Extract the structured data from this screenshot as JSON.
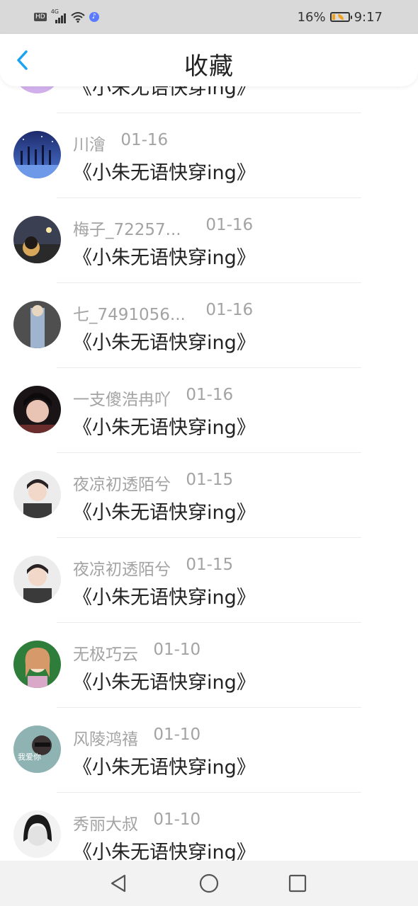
{
  "status_bar": {
    "hd": "HD",
    "network": "4G",
    "music": "♪",
    "battery": "16%",
    "time": "9:17"
  },
  "header": {
    "title": "收藏"
  },
  "items": [
    {
      "name": "",
      "date": "",
      "title": "《小朱无语快穿ing》"
    },
    {
      "name": "川澮",
      "date": "01-16",
      "title": "《小朱无语快穿ing》"
    },
    {
      "name": "梅子_72257...",
      "date": "01-16",
      "title": "《小朱无语快穿ing》"
    },
    {
      "name": "七_7491056...",
      "date": "01-16",
      "title": "《小朱无语快穿ing》"
    },
    {
      "name": "一支傻浩冉吖",
      "date": "01-16",
      "title": "《小朱无语快穿ing》"
    },
    {
      "name": "夜凉初透陌兮",
      "date": "01-15",
      "title": "《小朱无语快穿ing》"
    },
    {
      "name": "夜凉初透陌兮",
      "date": "01-15",
      "title": "《小朱无语快穿ing》"
    },
    {
      "name": "无极巧云",
      "date": "01-10",
      "title": "《小朱无语快穿ing》"
    },
    {
      "name": "风陵鸿禧",
      "date": "01-10",
      "title": "《小朱无语快穿ing》",
      "avatar_text": "我爱你"
    },
    {
      "name": "秀丽大叔",
      "date": "01-10",
      "title": "《小朱无语快穿ing》"
    }
  ],
  "icons": {
    "back": "chevron-left-icon",
    "nav_back": "triangle-back-icon",
    "nav_home": "circle-home-icon",
    "nav_recent": "square-recent-icon"
  },
  "colors": {
    "accent": "#1aa3f2",
    "status_bar_bg": "#d9d9d9",
    "meta_text": "#a3a3a3",
    "title_text": "#222222",
    "battery": "#f2a11f"
  }
}
